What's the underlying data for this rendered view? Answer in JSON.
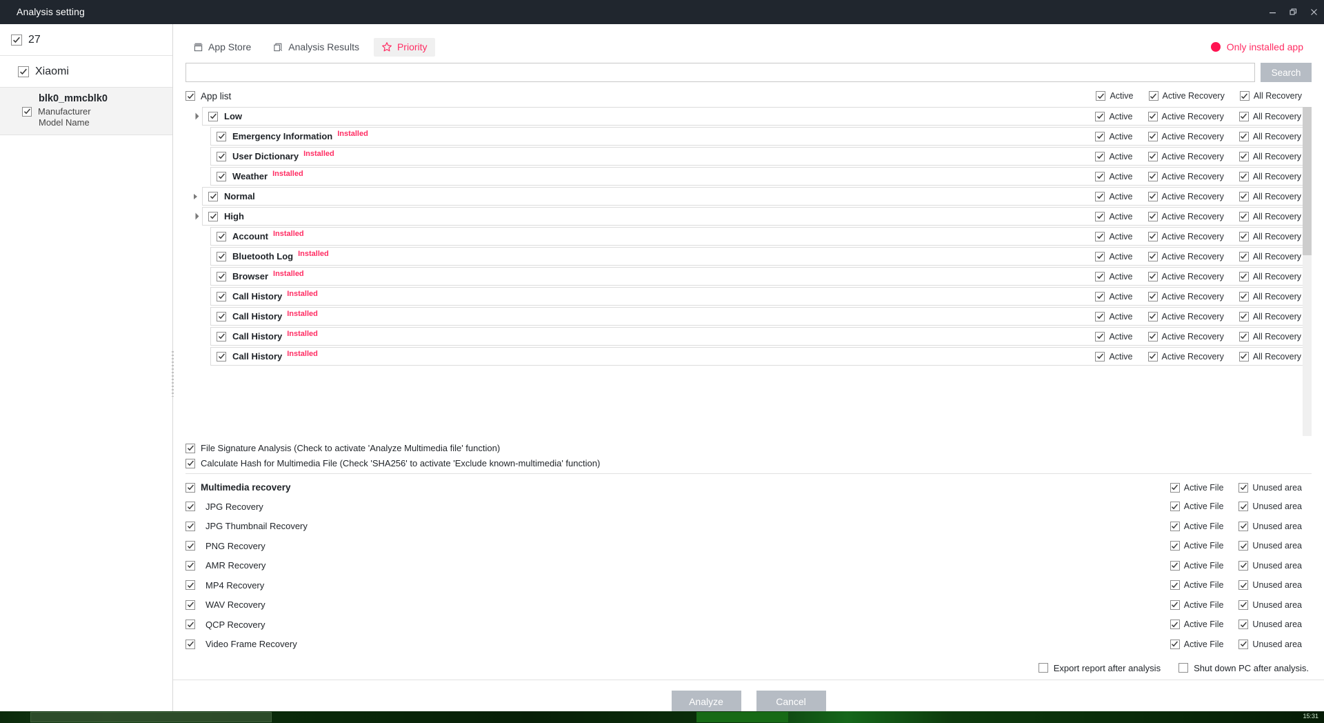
{
  "window": {
    "title": "Analysis setting",
    "controls": [
      {
        "name": "minimize-button",
        "glyph": "minimize"
      },
      {
        "name": "restore-button",
        "glyph": "restore"
      },
      {
        "name": "close-button",
        "glyph": "close"
      }
    ]
  },
  "sidebar": {
    "root": {
      "label": "27",
      "checked": true
    },
    "vendor": {
      "label": "Xiaomi",
      "checked": true
    },
    "device": {
      "name": "blk0_mmcblk0",
      "manufacturer_label": "Manufacturer",
      "manufacturer_checked": true,
      "model_label": "Model Name"
    }
  },
  "main": {
    "tabs": [
      {
        "label": "App Store",
        "icon": "app-store-icon",
        "active": false
      },
      {
        "label": "Analysis Results",
        "icon": "analysis-results-icon",
        "active": false
      },
      {
        "label": "Priority",
        "icon": "star-icon",
        "active": true
      }
    ],
    "only_installed": {
      "label": "Only installed app",
      "color": "#ff1452"
    },
    "search": {
      "value": "",
      "placeholder": "",
      "button_label": "Search",
      "button_disabled": true
    },
    "app_list_header": {
      "label": "App list",
      "checked": true,
      "options": [
        {
          "label": "Active",
          "checked": true
        },
        {
          "label": "Active Recovery",
          "checked": true
        },
        {
          "label": "All Recovery",
          "checked": true
        }
      ]
    },
    "option_labels": [
      "Active",
      "Active Recovery",
      "All Recovery"
    ],
    "groups": [
      {
        "label": "Low",
        "checked": true,
        "expanded": true,
        "options": [
          true,
          true,
          true
        ],
        "apps": [
          {
            "label": "Emergency Information",
            "badge": "Installed",
            "checked": true,
            "options": [
              true,
              true,
              true
            ]
          },
          {
            "label": "User Dictionary",
            "badge": "Installed",
            "checked": true,
            "options": [
              true,
              true,
              true
            ]
          },
          {
            "label": "Weather",
            "badge": "Installed",
            "checked": true,
            "options": [
              true,
              true,
              true
            ]
          }
        ]
      },
      {
        "label": "Normal",
        "checked": true,
        "expanded": false,
        "options": [
          true,
          true,
          true
        ],
        "apps": []
      },
      {
        "label": "High",
        "checked": true,
        "expanded": true,
        "options": [
          true,
          true,
          true
        ],
        "apps": [
          {
            "label": "Account",
            "badge": "Installed",
            "checked": true,
            "options": [
              true,
              true,
              true
            ]
          },
          {
            "label": "Bluetooth Log",
            "badge": "Installed",
            "checked": true,
            "options": [
              true,
              true,
              true
            ]
          },
          {
            "label": "Browser",
            "badge": "Installed",
            "checked": true,
            "options": [
              true,
              true,
              true
            ]
          },
          {
            "label": "Call History",
            "badge": "Installed",
            "checked": true,
            "options": [
              true,
              true,
              true
            ]
          },
          {
            "label": "Call History",
            "badge": "Installed",
            "checked": true,
            "options": [
              true,
              true,
              true
            ]
          },
          {
            "label": "Call History",
            "badge": "Installed",
            "checked": true,
            "options": [
              true,
              true,
              true
            ]
          },
          {
            "label": "Call History",
            "badge": "Installed",
            "checked": true,
            "options": [
              true,
              true,
              true
            ]
          }
        ]
      }
    ],
    "analysis_options": [
      {
        "label": "File Signature Analysis (Check to activate 'Analyze Multimedia file' function)",
        "checked": true
      },
      {
        "label": "Calculate Hash for Multimedia File    (Check 'SHA256' to activate 'Exclude known-multimedia' function)",
        "checked": true
      }
    ],
    "multimedia": {
      "header": {
        "label": "Multimedia recovery",
        "checked": true
      },
      "option_labels": [
        "Active File",
        "Unused area"
      ],
      "header_options": [
        true,
        true
      ],
      "items": [
        {
          "label": "JPG Recovery",
          "checked": true,
          "options": [
            true,
            true
          ]
        },
        {
          "label": "JPG Thumbnail Recovery",
          "checked": true,
          "options": [
            true,
            true
          ]
        },
        {
          "label": "PNG Recovery",
          "checked": true,
          "options": [
            true,
            true
          ]
        },
        {
          "label": "AMR Recovery",
          "checked": true,
          "options": [
            true,
            true
          ]
        },
        {
          "label": "MP4 Recovery",
          "checked": true,
          "options": [
            true,
            true
          ]
        },
        {
          "label": "WAV Recovery",
          "checked": true,
          "options": [
            true,
            true
          ]
        },
        {
          "label": "QCP Recovery",
          "checked": true,
          "options": [
            true,
            true
          ]
        },
        {
          "label": "Video Frame Recovery",
          "checked": true,
          "options": [
            true,
            true
          ]
        }
      ]
    }
  },
  "footer": {
    "options": [
      {
        "label": "Export report after analysis",
        "checked": false
      },
      {
        "label": "Shut down PC after analysis.",
        "checked": false
      }
    ],
    "buttons": [
      {
        "label": "Analyze",
        "disabled": true
      },
      {
        "label": "Cancel",
        "disabled": true
      }
    ]
  },
  "taskbar": {
    "clock": "15:31"
  }
}
